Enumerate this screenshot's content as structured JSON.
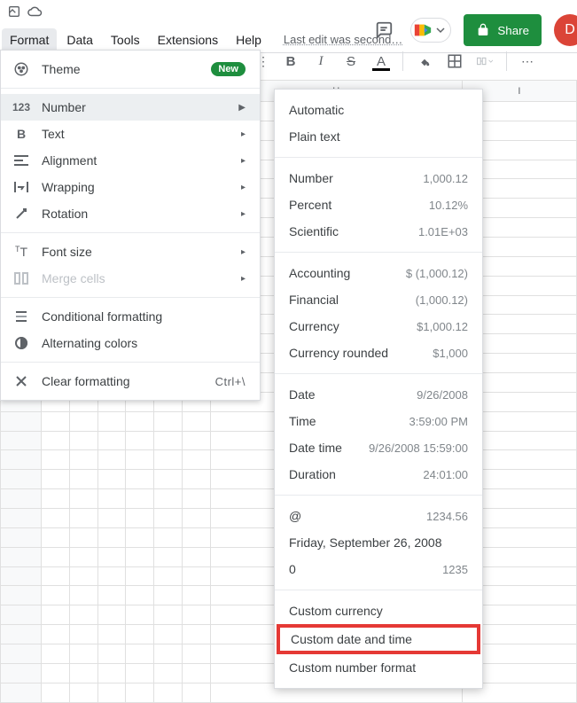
{
  "top": {
    "share": "Share",
    "avatar_initial": "D"
  },
  "menubar": {
    "items": [
      "Format",
      "Data",
      "Tools",
      "Extensions",
      "Help"
    ],
    "last_edit": "Last edit was second…"
  },
  "format_menu": {
    "theme": "Theme",
    "badge": "New",
    "number": "Number",
    "text": "Text",
    "alignment": "Alignment",
    "wrapping": "Wrapping",
    "rotation": "Rotation",
    "fontsize": "Font size",
    "merge": "Merge cells",
    "cond": "Conditional formatting",
    "altcolors": "Alternating colors",
    "clear": "Clear formatting",
    "clear_shortcut": "Ctrl+\\"
  },
  "number_menu": {
    "automatic": "Automatic",
    "plain": "Plain text",
    "number_l": "Number",
    "number_e": "1,000.12",
    "percent_l": "Percent",
    "percent_e": "10.12%",
    "sci_l": "Scientific",
    "sci_e": "1.01E+03",
    "acct_l": "Accounting",
    "acct_e": "$ (1,000.12)",
    "fin_l": "Financial",
    "fin_e": "(1,000.12)",
    "cur_l": "Currency",
    "cur_e": "$1,000.12",
    "curr_l": "Currency rounded",
    "curr_e": "$1,000",
    "date_l": "Date",
    "date_e": "9/26/2008",
    "time_l": "Time",
    "time_e": "3:59:00 PM",
    "dt_l": "Date time",
    "dt_e": "9/26/2008 15:59:00",
    "dur_l": "Duration",
    "dur_e": "24:01:00",
    "at_l": "@",
    "at_e": "1234.56",
    "long_l": "Friday, September 26, 2008",
    "zero_l": "0",
    "zero_e": "1235",
    "custcur": "Custom currency",
    "custdt": "Custom date and time",
    "custnum": "Custom number format"
  },
  "grid": {
    "col_h": "H",
    "col_i": "I"
  }
}
